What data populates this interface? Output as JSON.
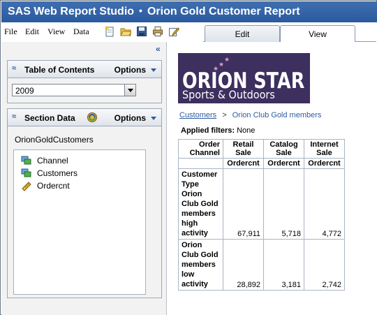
{
  "app": {
    "name": "SAS Web Report Studio",
    "separator": "•",
    "report_title": "Orion Gold Customer Report"
  },
  "menu": {
    "file": "File",
    "edit": "Edit",
    "view": "View",
    "data": "Data"
  },
  "toolbar_icons": [
    "new-report-icon",
    "open-folder-icon",
    "save-icon",
    "print-icon",
    "edit-report-icon"
  ],
  "tabs": {
    "edit": "Edit",
    "view": "View"
  },
  "left_pane": {
    "collapse_glyph": "«",
    "toc": {
      "title": "Table of Contents",
      "options_label": "Options",
      "selected": "2009"
    },
    "section_data": {
      "title": "Section Data",
      "options_label": "Options",
      "data_source": "OrionGoldCustomers",
      "items": [
        {
          "label": "Channel",
          "icon": "category-icon"
        },
        {
          "label": "Customers",
          "icon": "category-icon"
        },
        {
          "label": "Ordercnt",
          "icon": "measure-icon"
        }
      ]
    }
  },
  "report": {
    "logo": {
      "line1": "ORION STAR",
      "line2": "Sports & Outdoors"
    },
    "breadcrumb": {
      "root": "Customers",
      "sep": ">",
      "current": "Orion Club Gold members"
    },
    "filters": {
      "label": "Applied filters:",
      "value": "None"
    },
    "table": {
      "corner_top": "Order Channel",
      "corner_left": "Customer Type",
      "channels": [
        "Retail Sale",
        "Catalog Sale",
        "Internet Sale"
      ],
      "measure": "Ordercnt",
      "rows": [
        {
          "label": "Orion Club Gold members high activity",
          "values": [
            "67,911",
            "5,718",
            "4,772"
          ]
        },
        {
          "label": "Orion Club Gold members low activity",
          "values": [
            "28,892",
            "3,181",
            "2,742"
          ]
        }
      ]
    }
  }
}
